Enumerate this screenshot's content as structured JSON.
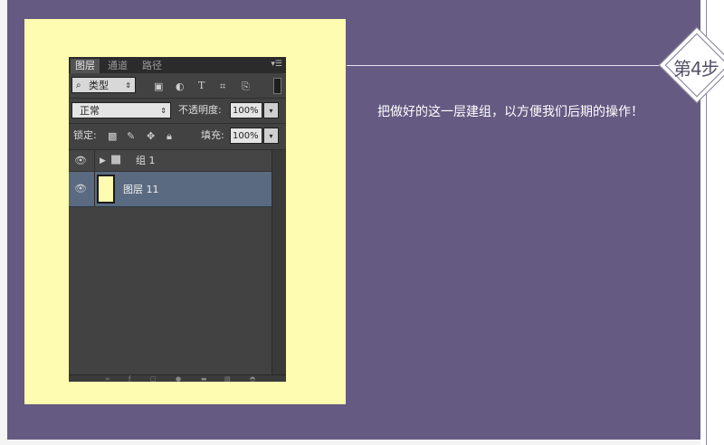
{
  "step": {
    "label": "第4步"
  },
  "description": "把做好的这一层建组，以方便我们后期的操作！",
  "panel": {
    "tabs": [
      {
        "label": "图层"
      },
      {
        "label": "通道"
      },
      {
        "label": "路径"
      }
    ],
    "filter": {
      "kind_label": "类型"
    },
    "blend_mode": "正常",
    "opacity": {
      "label": "不透明度:",
      "value": "100%"
    },
    "lock": {
      "label": "锁定:"
    },
    "fill": {
      "label": "填充:",
      "value": "100%"
    },
    "layers": [
      {
        "name": "组 1",
        "type": "group",
        "visible": true,
        "selected": false
      },
      {
        "name": "图层 11",
        "type": "layer",
        "visible": true,
        "selected": true
      }
    ]
  },
  "colors": {
    "background": "#645a82",
    "card": "#fefcb0",
    "panel": "#424242",
    "selected_layer": "#5a6a80"
  },
  "icons": [
    "search-icon",
    "image-filter-icon",
    "adjustment-filter-icon",
    "type-filter-icon",
    "shape-filter-icon",
    "smart-object-filter-icon",
    "eye-icon",
    "folder-icon",
    "lock-pixels-icon",
    "lock-brush-icon",
    "lock-move-icon",
    "lock-all-icon"
  ]
}
